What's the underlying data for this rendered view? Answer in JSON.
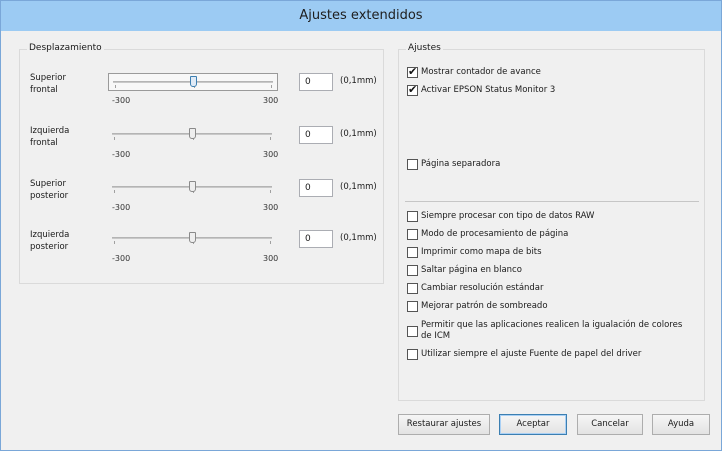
{
  "window": {
    "title": "Ajustes extendidos"
  },
  "desplazamiento": {
    "group_label": "Desplazamiento",
    "sliders": [
      {
        "label_line1": "Superior",
        "label_line2": "frontal",
        "value": "0",
        "unit": "(0,1mm)",
        "min_label": "-300",
        "max_label": "300"
      },
      {
        "label_line1": "Izquierda",
        "label_line2": "frontal",
        "value": "0",
        "unit": "(0,1mm)",
        "min_label": "-300",
        "max_label": "300"
      },
      {
        "label_line1": "Superior",
        "label_line2": "posterior",
        "value": "0",
        "unit": "(0,1mm)",
        "min_label": "-300",
        "max_label": "300"
      },
      {
        "label_line1": "Izquierda",
        "label_line2": "posterior",
        "value": "0",
        "unit": "(0,1mm)",
        "min_label": "-300",
        "max_label": "300"
      }
    ]
  },
  "ajustes": {
    "group_label": "Ajustes",
    "top_options": [
      {
        "label": "Mostrar contador de avance",
        "checked": true
      },
      {
        "label": "Activar EPSON Status Monitor 3",
        "checked": true
      },
      {
        "label": "Página separadora",
        "checked": false
      }
    ],
    "options": [
      {
        "label": "Siempre procesar con tipo de datos RAW",
        "checked": false
      },
      {
        "label": "Modo de procesamiento de página",
        "checked": false
      },
      {
        "label": "Imprimir como mapa de bits",
        "checked": false
      },
      {
        "label": "Saltar página en blanco",
        "checked": false
      },
      {
        "label": "Cambiar resolución estándar",
        "checked": false
      },
      {
        "label": "Mejorar patrón de sombreado",
        "checked": false
      },
      {
        "label_line1": "Permitir que las aplicaciones realicen la igualación de colores",
        "label_line2": "de ICM",
        "checked": false
      },
      {
        "label": "Utilizar siempre el ajuste Fuente de papel del driver",
        "checked": false
      }
    ]
  },
  "buttons": {
    "restore": "Restaurar ajustes",
    "accept": "Aceptar",
    "cancel": "Cancelar",
    "help": "Ayuda"
  }
}
